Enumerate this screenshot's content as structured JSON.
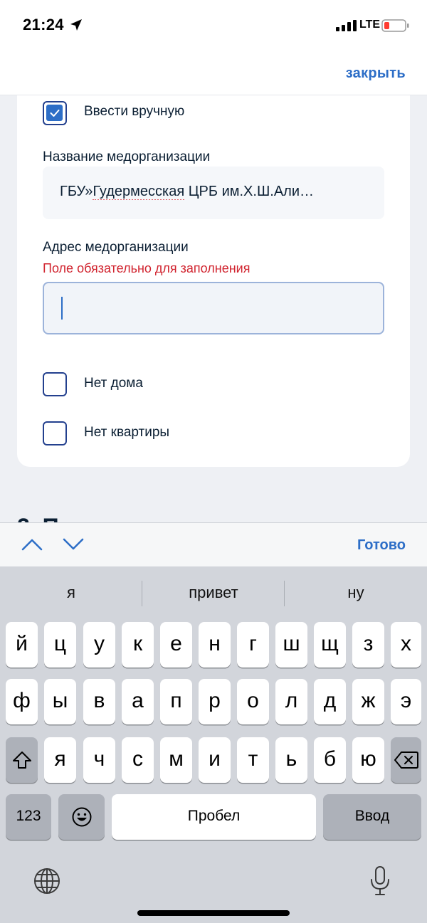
{
  "status_bar": {
    "time": "21:24",
    "network": "LTE"
  },
  "topnav": {
    "close_label": "закрыть"
  },
  "form": {
    "manual_checkbox": {
      "label": "Ввести вручную",
      "checked": true
    },
    "org_name": {
      "label": "Название медорганизации",
      "value_prefix": "ГБУ»",
      "value_spell": "Гудермесская",
      "value_suffix": " ЦРБ им.Х.Ш.Али…"
    },
    "org_address": {
      "label": "Адрес медорганизации",
      "error": "Поле обязательно для заполнения",
      "value": ""
    },
    "no_house": {
      "label": "Нет дома",
      "checked": false
    },
    "no_apartment": {
      "label": "Нет квартиры",
      "checked": false
    },
    "next_heading_peek": "2. П"
  },
  "accessory": {
    "done_label": "Готово"
  },
  "keyboard": {
    "suggestions": [
      "я",
      "привет",
      "ну"
    ],
    "row1": [
      "й",
      "ц",
      "у",
      "к",
      "е",
      "н",
      "г",
      "ш",
      "щ",
      "з",
      "х"
    ],
    "row2": [
      "ф",
      "ы",
      "в",
      "а",
      "п",
      "р",
      "о",
      "л",
      "д",
      "ж",
      "э"
    ],
    "row3": [
      "я",
      "ч",
      "с",
      "м",
      "и",
      "т",
      "ь",
      "б",
      "ю"
    ],
    "numbers_label": "123",
    "space_label": "Пробел",
    "return_label": "Ввод"
  },
  "colors": {
    "accent": "#2d6ec7",
    "checkbox_border": "#23408e",
    "error": "#d1242f"
  },
  "icons": [
    "location-arrow-icon",
    "signal-icon",
    "battery-low-icon",
    "checkmark-icon",
    "chevron-up-icon",
    "chevron-down-icon",
    "shift-icon",
    "backspace-icon",
    "emoji-icon",
    "globe-icon",
    "microphone-icon"
  ]
}
